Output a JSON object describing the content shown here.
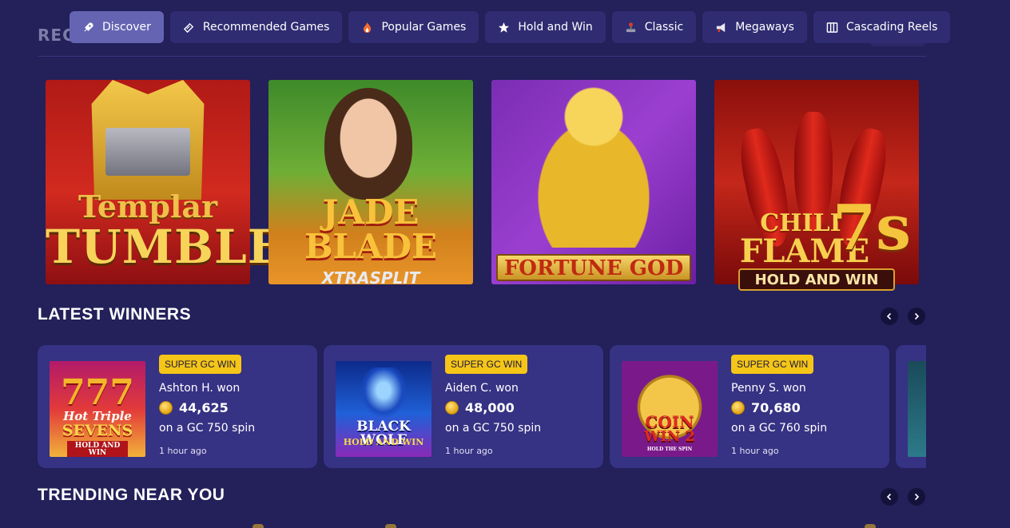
{
  "nav": {
    "tabs": [
      {
        "label": "Discover",
        "icon": "rocket-icon",
        "active": true
      },
      {
        "label": "Recommended Games",
        "icon": "ticket-icon",
        "active": false
      },
      {
        "label": "Popular Games",
        "icon": "flame-icon",
        "active": false
      },
      {
        "label": "Hold and Win",
        "icon": "star-icon",
        "active": false
      },
      {
        "label": "Classic",
        "icon": "joystick-icon",
        "active": false
      },
      {
        "label": "Megaways",
        "icon": "megaphone-icon",
        "active": false
      },
      {
        "label": "Cascading Reels",
        "icon": "columns-icon",
        "active": false
      }
    ]
  },
  "hidden_section": {
    "heading": "REC"
  },
  "games": [
    {
      "title_line1": "Templar",
      "title_line2": "TUMBLE"
    },
    {
      "title_line1": "JADE",
      "title_line2": "BLADE",
      "title_line3": "XTRASPLIT"
    },
    {
      "title_line1": "FORTUNE GOD"
    },
    {
      "title_line1": "CHILI",
      "title_line2": "FLAME",
      "title_line3": "7s",
      "banner": "HOLD AND WIN"
    }
  ],
  "latest_winners": {
    "heading": "LATEST WINNERS",
    "cards": [
      {
        "badge": "SUPER GC WIN",
        "name": "Ashton H. won",
        "amount": "44,625",
        "spin": "on a GC 750 spin",
        "time": "1 hour ago",
        "thumb_line1": "Hot Triple",
        "thumb_line2": "SEVENS",
        "thumb_line3": "HOLD AND WIN"
      },
      {
        "badge": "SUPER GC WIN",
        "name": "Aiden C. won",
        "amount": "48,000",
        "spin": "on a GC 750 spin",
        "time": "1 hour ago",
        "thumb_line1": "BLACK WOLF",
        "thumb_line2": "HOLD AND WIN"
      },
      {
        "badge": "SUPER GC WIN",
        "name": "Penny S. won",
        "amount": "70,680",
        "spin": "on a GC 760 spin",
        "time": "1 hour ago",
        "thumb_line1": "COIN",
        "thumb_line2": "WIN 2",
        "thumb_line3": "HOLD THE SPIN"
      }
    ]
  },
  "trending": {
    "heading": "TRENDING NEAR YOU"
  },
  "colors": {
    "background": "#23205a",
    "tab": "#2f2c72",
    "tab_active": "#6564b3",
    "card": "#363284",
    "badge": "#f5c518"
  }
}
